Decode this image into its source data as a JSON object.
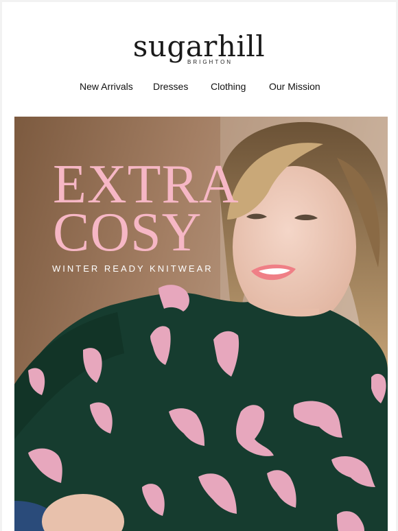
{
  "brand": {
    "name": "sugarhill",
    "sub": "BRIGHTON"
  },
  "nav": [
    {
      "label": "New Arrivals"
    },
    {
      "label": "Dresses"
    },
    {
      "label": "Clothing"
    },
    {
      "label": "Our Mission"
    }
  ],
  "hero": {
    "headline_1": "EXTRA",
    "headline_2": "COSY",
    "tagline": "WINTER READY KNITWEAR"
  },
  "colors": {
    "accent_pink": "#f6b7c5",
    "sweater_green": "#163c2f"
  }
}
